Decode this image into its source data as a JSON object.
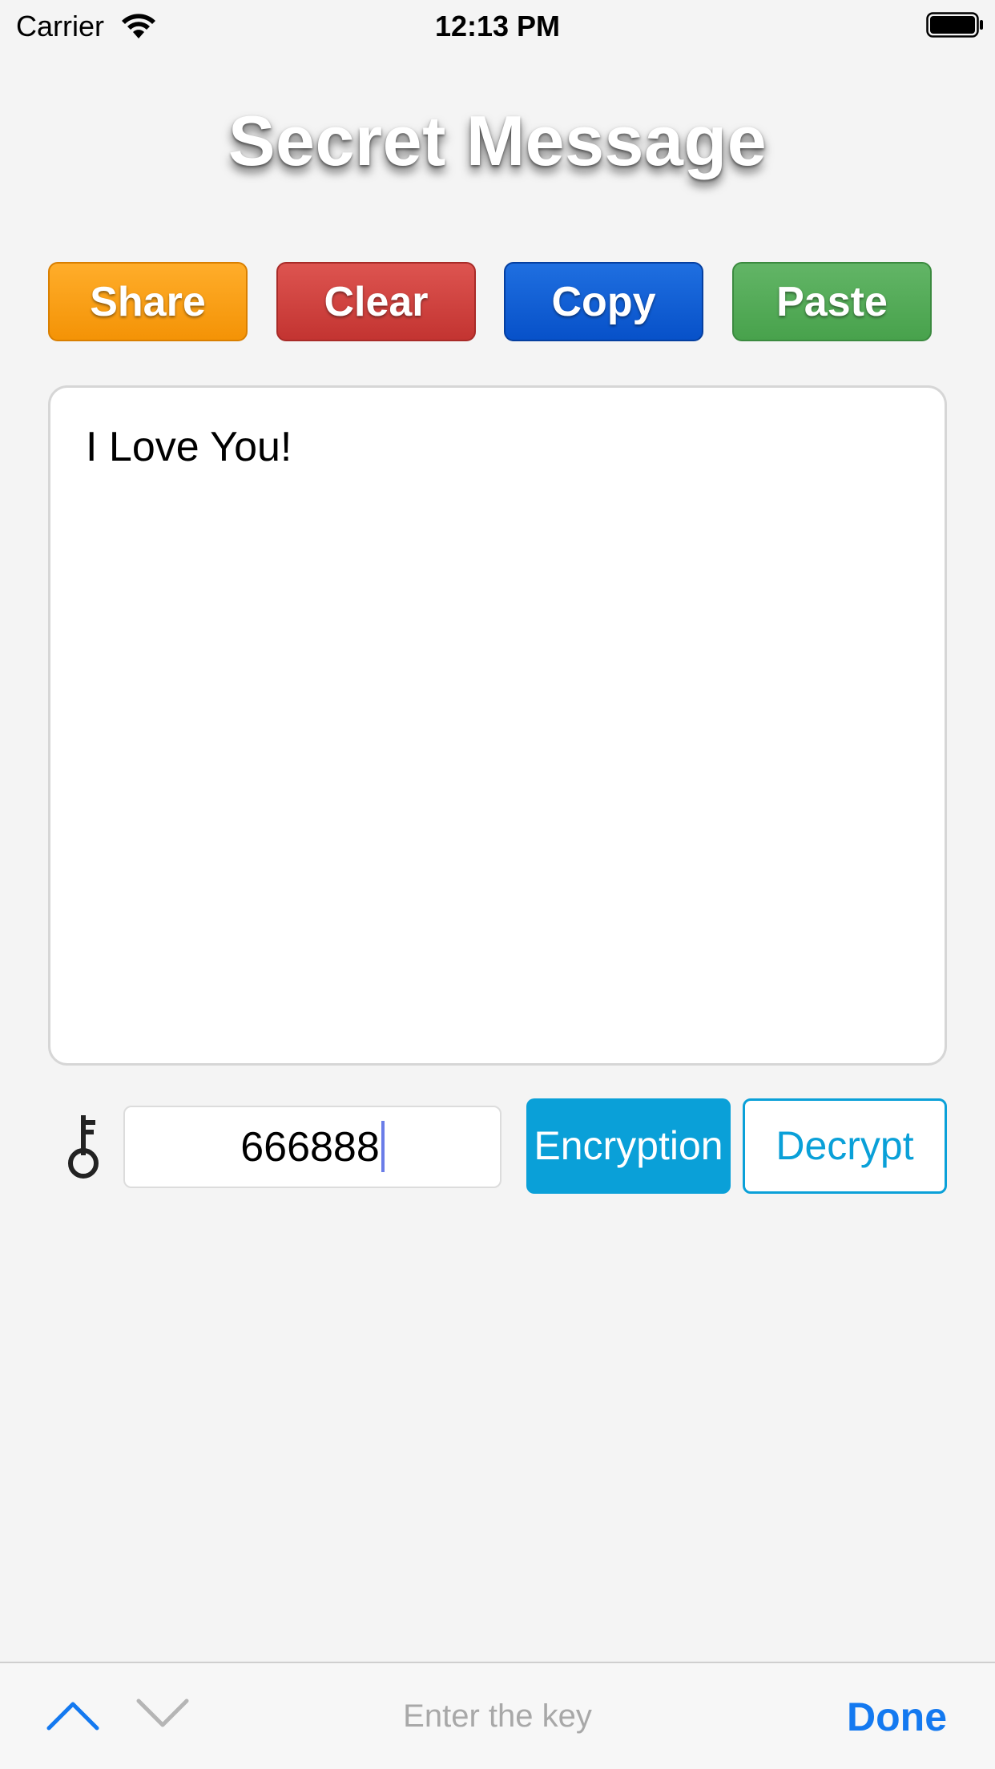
{
  "status_bar": {
    "carrier": "Carrier",
    "time": "12:13 PM",
    "wifi_icon": "wifi-icon",
    "battery_icon": "battery-icon"
  },
  "title": "Secret Message",
  "actions": {
    "share": "Share",
    "clear": "Clear",
    "copy": "Copy",
    "paste": "Paste"
  },
  "colors": {
    "share": "#f49306",
    "clear": "#c33431",
    "copy": "#0751c9",
    "paste": "#48a24c",
    "accent": "#0aa0d8",
    "done": "#1479f0"
  },
  "message": {
    "text": "I Love You!"
  },
  "key": {
    "icon": "key-icon",
    "value": "666888"
  },
  "crypto": {
    "encrypt_label": "Encryption",
    "decrypt_label": "Decrypt"
  },
  "toolbar": {
    "prev_icon": "chevron-up-icon",
    "next_icon": "chevron-down-icon",
    "hint": "Enter the key",
    "done_label": "Done"
  }
}
